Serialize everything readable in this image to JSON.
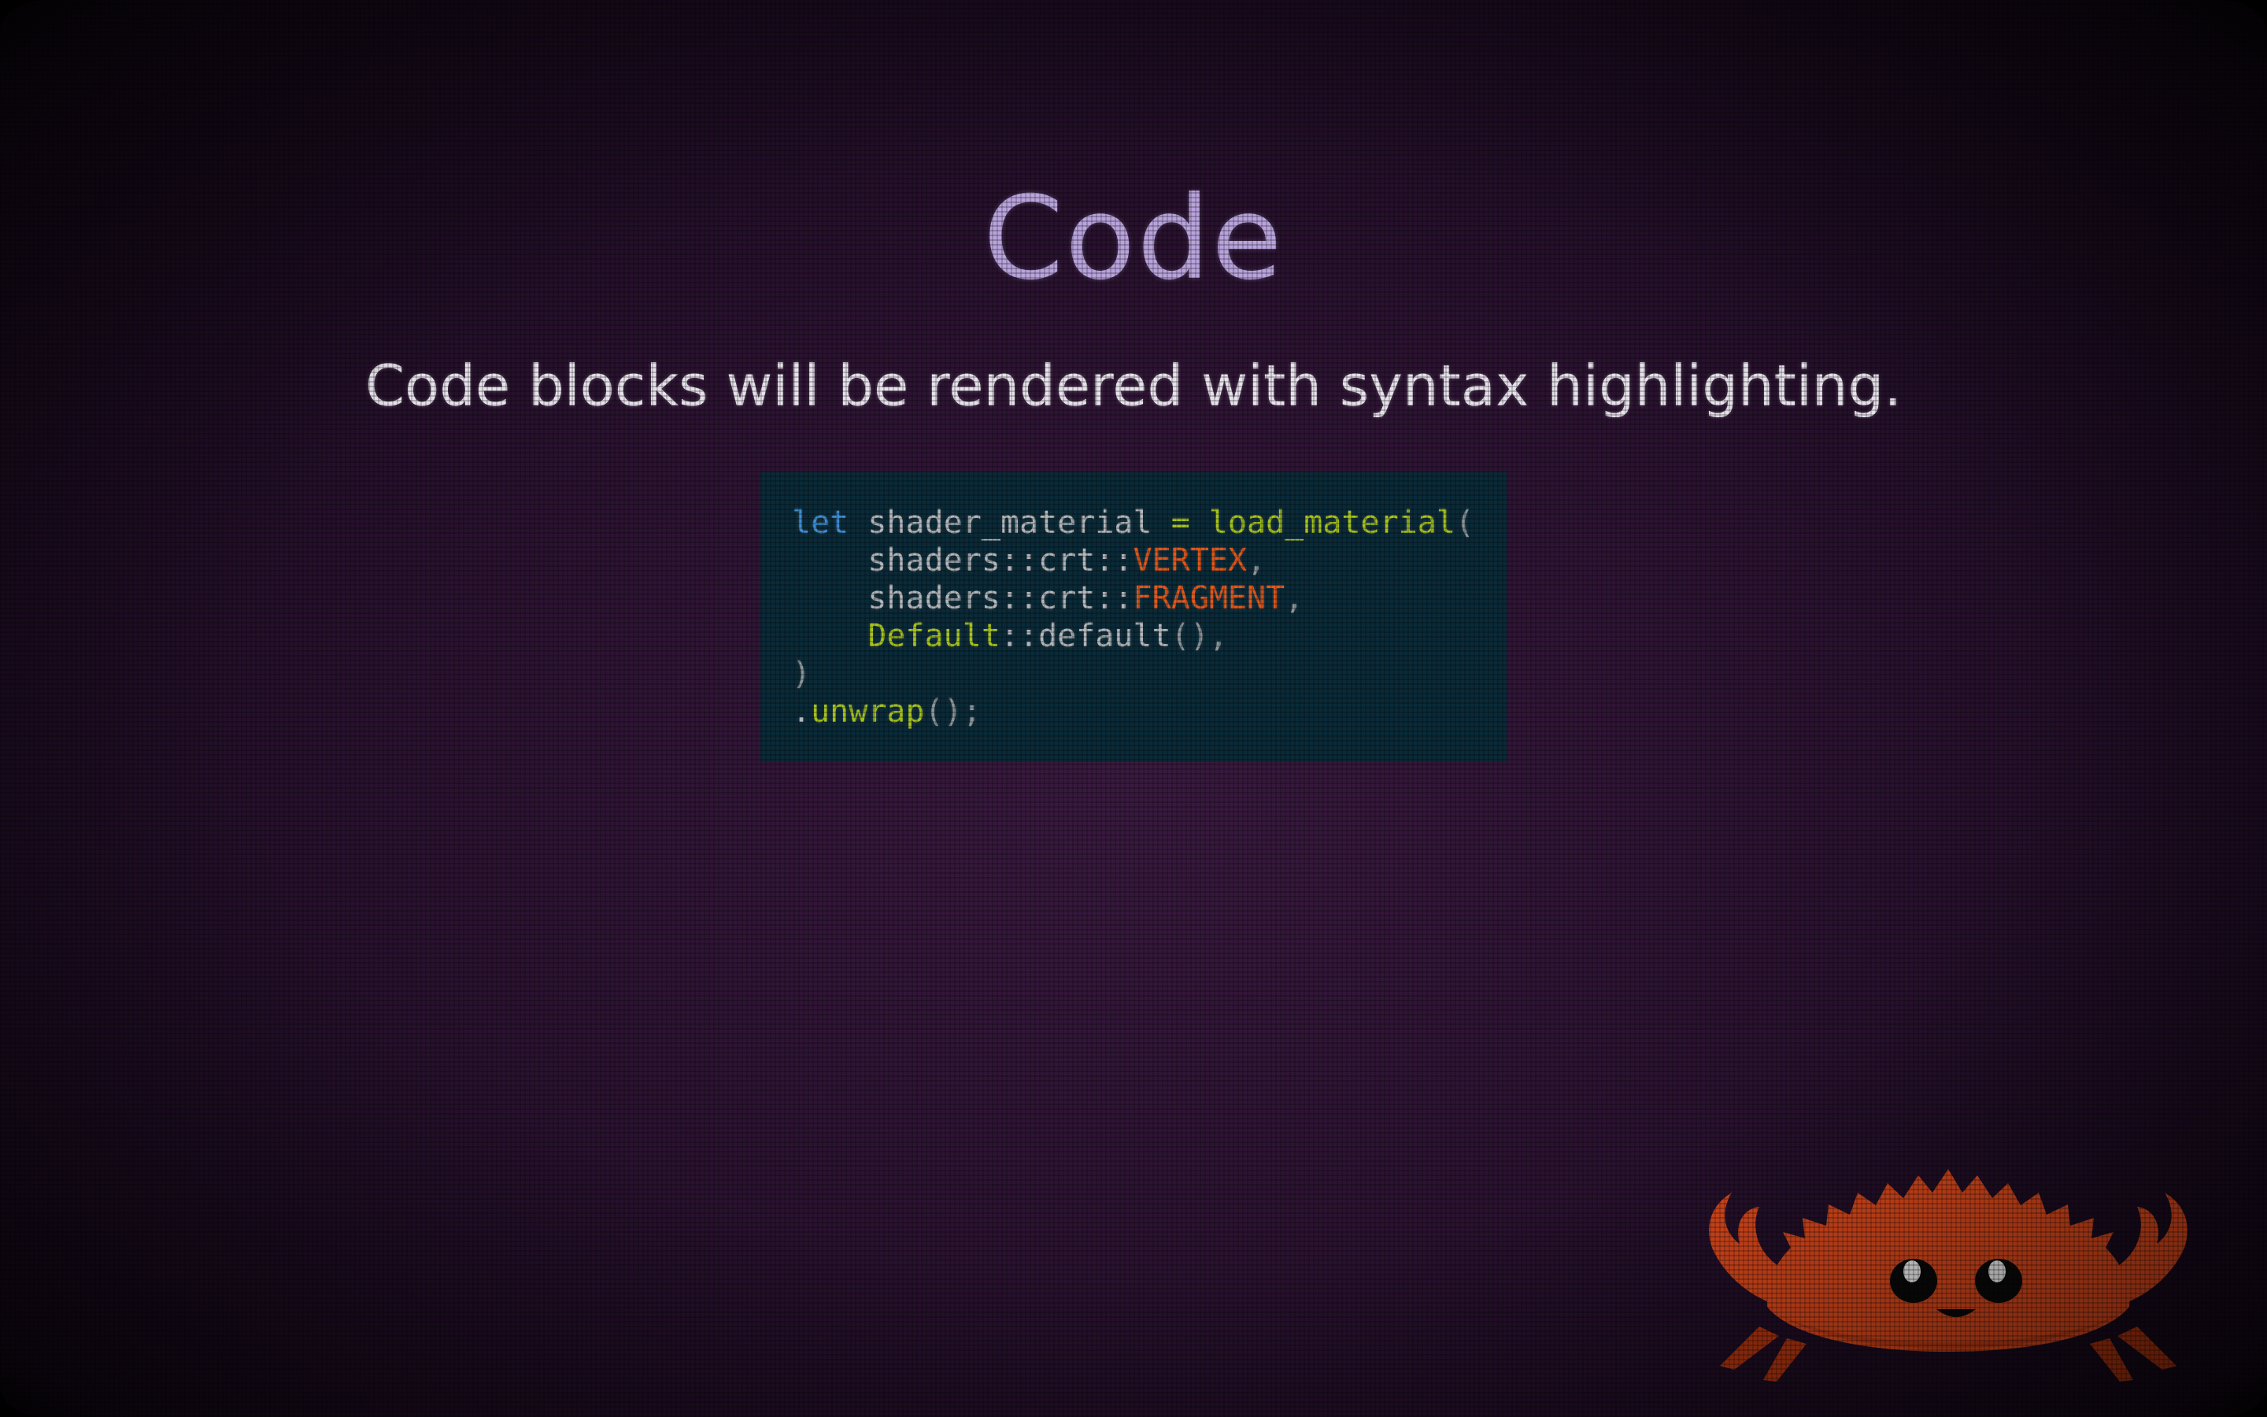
{
  "slide": {
    "title": "Code",
    "subtitle": "Code blocks will be rendered with syntax highlighting."
  },
  "code": {
    "language": "rust",
    "lines": [
      [
        {
          "t": "let",
          "c": "kw"
        },
        {
          "t": " shader_material ",
          "c": "plain"
        },
        {
          "t": "=",
          "c": "op"
        },
        {
          "t": " ",
          "c": "plain"
        },
        {
          "t": "load_material",
          "c": "fn"
        },
        {
          "t": "(",
          "c": "punct"
        }
      ],
      [
        {
          "t": "    shaders::crt::",
          "c": "plain"
        },
        {
          "t": "VERTEX",
          "c": "const"
        },
        {
          "t": ",",
          "c": "punct"
        }
      ],
      [
        {
          "t": "    shaders::crt::",
          "c": "plain"
        },
        {
          "t": "FRAGMENT",
          "c": "const"
        },
        {
          "t": ",",
          "c": "punct"
        }
      ],
      [
        {
          "t": "    ",
          "c": "plain"
        },
        {
          "t": "Default",
          "c": "type"
        },
        {
          "t": "::default",
          "c": "plain"
        },
        {
          "t": "(),",
          "c": "punct"
        }
      ],
      [
        {
          "t": ")",
          "c": "punct"
        }
      ],
      [
        {
          "t": ".",
          "c": "plain"
        },
        {
          "t": "unwrap",
          "c": "fn"
        },
        {
          "t": "();",
          "c": "punct"
        }
      ]
    ]
  },
  "mascot": {
    "icon": "ferris-crab-icon",
    "body_color": "#d9481c",
    "shadow_color": "#a8300d"
  }
}
